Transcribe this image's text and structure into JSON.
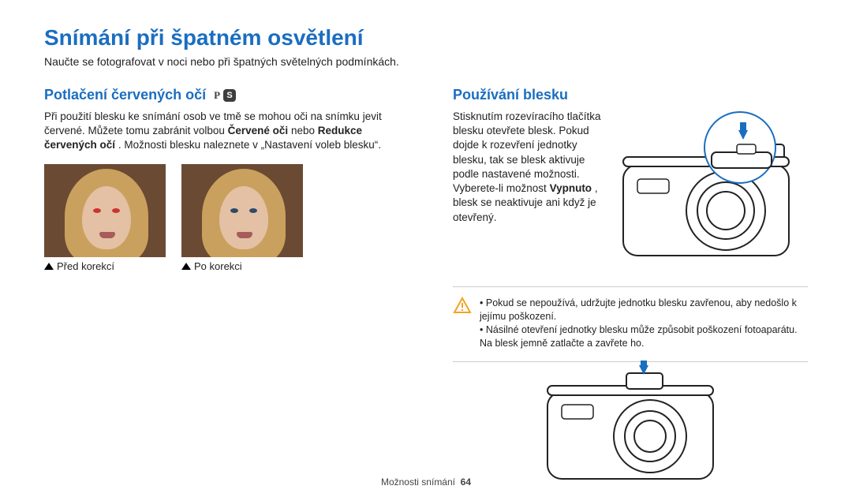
{
  "page": {
    "title": "Snímání při špatném osvětlení",
    "subtitle": "Naučte se fotografovat v noci nebo při špatných světelných podmínkách."
  },
  "redeye": {
    "heading": "Potlačení červených očí",
    "mode_p": "P",
    "mode_s": "S",
    "para_pre": "Při použití blesku ke snímání osob ve tmě se mohou oči na snímku jevit červené. Můžete tomu zabránit volbou ",
    "bold1": "Červené oči",
    "mid1": " nebo ",
    "bold2": "Redukce červených očí",
    "para_post": ". Možnosti blesku naleznete v „Nastavení voleb blesku“.",
    "caption_before": "Před korekcí",
    "caption_after": "Po korekci"
  },
  "flash": {
    "heading": "Používání blesku",
    "para_pre": "Stisknutím rozevíracího tlačítka blesku otevřete blesk. Pokud dojde k rozevření jednotky blesku, tak se blesk aktivuje podle nastavené možnosti. Vyberete-li možnost ",
    "bold": "Vypnuto",
    "para_post": ", blesk se neaktivuje ani když je otevřený."
  },
  "notes": {
    "n1": "Pokud se nepoužívá, udržujte jednotku blesku zavřenou, aby nedošlo k jejímu poškození.",
    "n2": "Násilné otevření jednotky blesku může způsobit poškození fotoaparátu. Na blesk jemně zatlačte a zavřete ho."
  },
  "footer": {
    "section": "Možnosti snímání",
    "page_no": "64"
  }
}
